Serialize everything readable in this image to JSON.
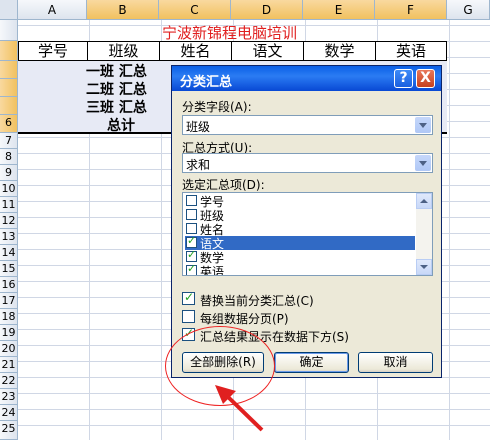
{
  "sheet": {
    "columns": [
      "A",
      "B",
      "C",
      "D",
      "E",
      "F",
      "G"
    ],
    "rows": [
      "",
      "",
      "",
      "",
      "",
      "6",
      "7",
      "8",
      "9",
      "10",
      "11",
      "12",
      "13",
      "14",
      "15",
      "16",
      "17",
      "18",
      "19",
      "20",
      "21",
      "22",
      "23",
      "24",
      "25"
    ],
    "title": "宁波新锦程电脑培训",
    "headers": [
      "学号",
      "班级",
      "姓名",
      "语文",
      "数学",
      "英语"
    ],
    "subtotals": [
      "一班 汇总",
      "二班 汇总",
      "三班 汇总",
      "总计"
    ]
  },
  "dialog": {
    "title": "分类汇总",
    "help": "?",
    "close": "X",
    "group_label": "分类字段(A):",
    "group_value": "班级",
    "func_label": "汇总方式(U):",
    "func_value": "求和",
    "items_label": "选定汇总项(D):",
    "items": [
      {
        "label": "学号",
        "checked": false
      },
      {
        "label": "班级",
        "checked": false
      },
      {
        "label": "姓名",
        "checked": false
      },
      {
        "label": "语文",
        "checked": true
      },
      {
        "label": "数学",
        "checked": true
      },
      {
        "label": "英语",
        "checked": true
      }
    ],
    "opt_replace": "替换当前分类汇总(C)",
    "opt_page": "每组数据分页(P)",
    "opt_below": "汇总结果显示在数据下方(S)",
    "btn_remove": "全部删除(R)",
    "btn_ok": "确定",
    "btn_cancel": "取消"
  }
}
